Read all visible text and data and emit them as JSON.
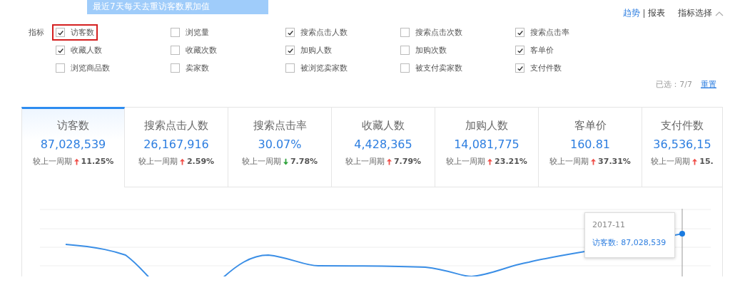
{
  "banner": {
    "text": "最近7天每天去重访客数累加值"
  },
  "view_tabs": [
    {
      "label": "趋势",
      "selected": true
    },
    {
      "label": "报表",
      "selected": false
    }
  ],
  "metric_picker": {
    "label": "指标选择",
    "expanded": true
  },
  "indicator_filter": {
    "label": "指标",
    "options": [
      {
        "label": "访客数",
        "checked": true,
        "highlighted": true
      },
      {
        "label": "浏览量",
        "checked": false,
        "highlighted": false
      },
      {
        "label": "搜索点击人数",
        "checked": true,
        "highlighted": false
      },
      {
        "label": "搜索点击次数",
        "checked": false,
        "highlighted": false
      },
      {
        "label": "搜索点击率",
        "checked": true,
        "highlighted": false
      },
      {
        "label": "收藏人数",
        "checked": true,
        "highlighted": false
      },
      {
        "label": "收藏次数",
        "checked": false,
        "highlighted": false
      },
      {
        "label": "加购人数",
        "checked": true,
        "highlighted": false
      },
      {
        "label": "加购次数",
        "checked": false,
        "highlighted": false
      },
      {
        "label": "客单价",
        "checked": true,
        "highlighted": false
      },
      {
        "label": "浏览商品数",
        "checked": false,
        "highlighted": false
      },
      {
        "label": "卖家数",
        "checked": false,
        "highlighted": false
      },
      {
        "label": "被浏览卖家数",
        "checked": false,
        "highlighted": false
      },
      {
        "label": "被支付卖家数",
        "checked": false,
        "highlighted": false
      },
      {
        "label": "支付件数",
        "checked": true,
        "highlighted": false
      }
    ],
    "selected_count": "已选：7/7",
    "reset": "重置"
  },
  "metric_cards": [
    {
      "title": "访客数",
      "value": "87,028,539",
      "compare_label": "较上一周期",
      "increase": true,
      "change": "11.25%",
      "selected": true
    },
    {
      "title": "搜索点击人数",
      "value": "26,167,916",
      "compare_label": "较上一周期",
      "increase": true,
      "change": "2.59%",
      "selected": false
    },
    {
      "title": "搜索点击率",
      "value": "30.07%",
      "compare_label": "较上一周期",
      "increase": false,
      "change": "7.78%",
      "selected": false
    },
    {
      "title": "收藏人数",
      "value": "4,428,365",
      "compare_label": "较上一周期",
      "increase": true,
      "change": "7.79%",
      "selected": false
    },
    {
      "title": "加购人数",
      "value": "14,081,775",
      "compare_label": "较上一周期",
      "increase": true,
      "change": "23.21%",
      "selected": false
    },
    {
      "title": "客单价",
      "value": "160.81",
      "compare_label": "较上一周期",
      "increase": true,
      "change": "37.31%",
      "selected": false
    },
    {
      "title": "支付件数",
      "value": "36,536,15",
      "compare_label": "较上一周期",
      "increase": true,
      "change": "15.",
      "selected": false
    }
  ],
  "chart_tooltip": {
    "date": "2017-11",
    "series_label": "访客数: 87,028,539"
  }
}
